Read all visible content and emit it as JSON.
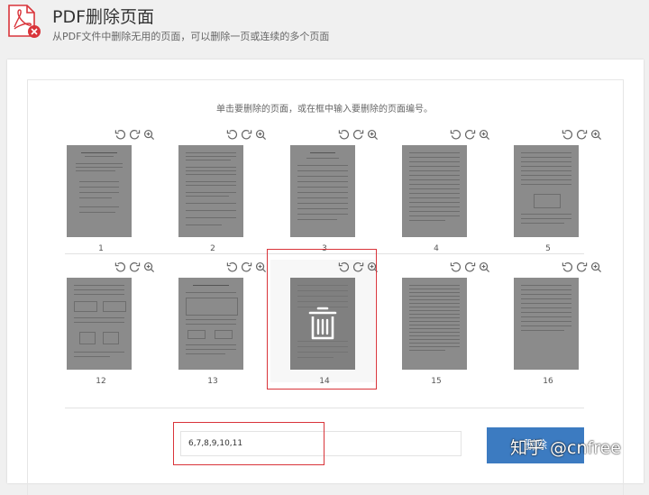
{
  "header": {
    "title": "PDF删除页面",
    "subtitle": "从PDF文件中删除无用的页面，可以删除一页或连续的多个页面"
  },
  "instruction": "单击要删除的页面，或在框中输入要删除的页面编号。",
  "pages": [
    {
      "number": "1"
    },
    {
      "number": "2"
    },
    {
      "number": "3"
    },
    {
      "number": "4"
    },
    {
      "number": "5"
    },
    {
      "number": "12"
    },
    {
      "number": "13"
    },
    {
      "number": "14"
    },
    {
      "number": "15"
    },
    {
      "number": "16"
    }
  ],
  "form": {
    "pages_input_value": "6,7,8,9,10,11",
    "delete_button_label": "删除"
  },
  "watermark": "知乎 @cnfree",
  "colors": {
    "accent": "#d9343a",
    "button": "#3c7bc1",
    "thumbnail": "#8b8b8b"
  },
  "icons": {
    "logo": "pdf-delete-logo-icon",
    "rotate_left": "rotate-left-icon",
    "rotate_right": "rotate-right-icon",
    "zoom": "zoom-in-icon",
    "trash": "trash-icon"
  }
}
